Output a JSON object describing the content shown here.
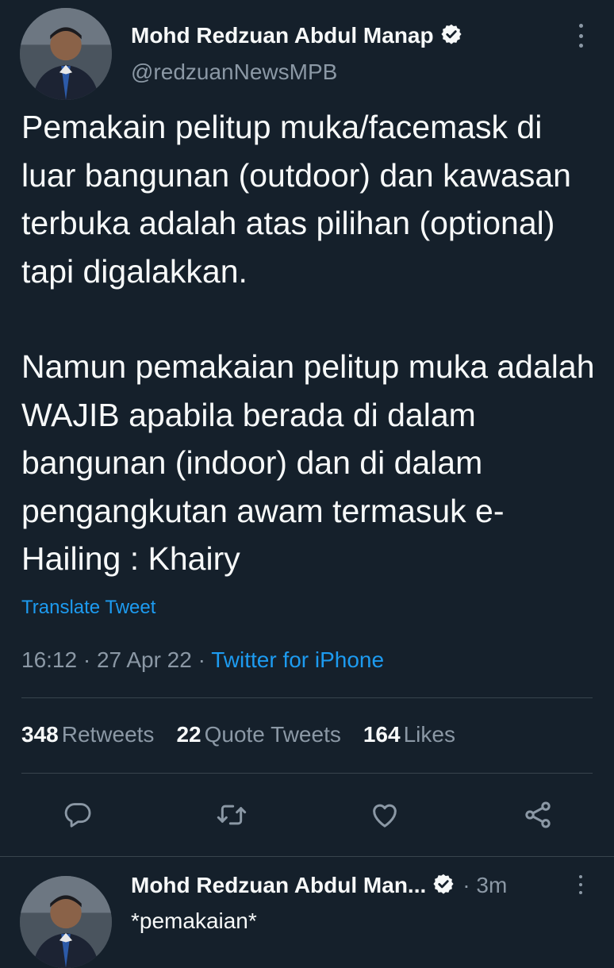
{
  "main_tweet": {
    "author_name": "Mohd Redzuan Abdul Manap",
    "handle": "@redzuanNewsMPB",
    "paragraphs": [
      "Pemakain pelitup muka/facemask di luar bangunan (outdoor) dan kawasan terbuka adalah atas pilihan (optional) tapi digalakkan.",
      "Namun pemakaian pelitup muka adalah WAJIB apabila berada di dalam bangunan (indoor) dan di dalam pengangkutan awam termasuk e- Hailing : Khairy"
    ],
    "translate_label": "Translate Tweet",
    "timestamp": "16:12 · 27 Apr 22 · ",
    "source": "Twitter for iPhone",
    "stats": {
      "retweets_count": "348",
      "retweets_label": "Retweets",
      "quotes_count": "22",
      "quotes_label": "Quote Tweets",
      "likes_count": "164",
      "likes_label": "Likes"
    }
  },
  "reply": {
    "author_name": "Mohd Redzuan Abdul Man...",
    "time": "· 3m",
    "text": "*pemakaian*"
  },
  "icons": {
    "verified": "verified-badge-icon",
    "more": "more-vertical-icon",
    "reply": "reply-icon",
    "retweet": "retweet-icon",
    "like": "heart-icon",
    "share": "share-icon"
  },
  "colors": {
    "background": "#15202b",
    "text": "#f7f9f9",
    "secondary": "#8b98a5",
    "accent": "#1d9bf0",
    "divider": "#38444d"
  }
}
